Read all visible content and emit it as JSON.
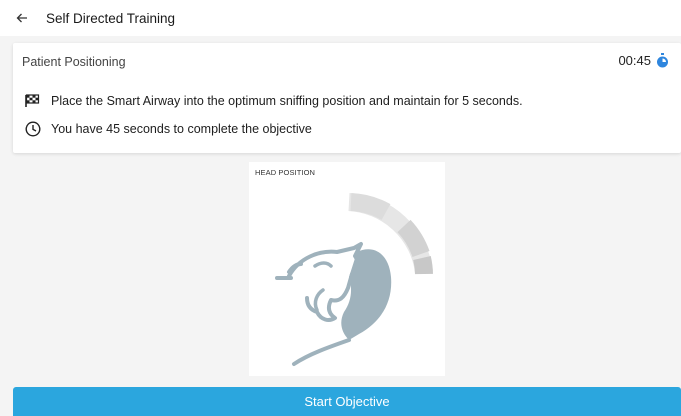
{
  "topbar": {
    "title": "Self Directed Training",
    "back_icon": "arrow-left-icon"
  },
  "objective_card": {
    "title": "Patient Positioning",
    "timer": "00:45",
    "timer_icon": "stopwatch-icon",
    "instruction": "Place the Smart Airway into the optimum sniffing position and maintain for 5 seconds.",
    "instruction_icon": "checkered-flag-icon",
    "time_note": "You have 45 seconds to complete the objective",
    "time_note_icon": "clock-icon"
  },
  "head_panel": {
    "label": "HEAD POSITION",
    "illustration": "head-profile-icon",
    "gauge_icon": "position-gauge-icon"
  },
  "start_button": {
    "label": "Start Objective"
  },
  "colors": {
    "accent": "#2ba6de",
    "timer_icon": "#2e86de",
    "head_fill": "#9fb2bc",
    "gauge_light": "#e6e6e6",
    "gauge_mid": "#d2d2d2"
  }
}
